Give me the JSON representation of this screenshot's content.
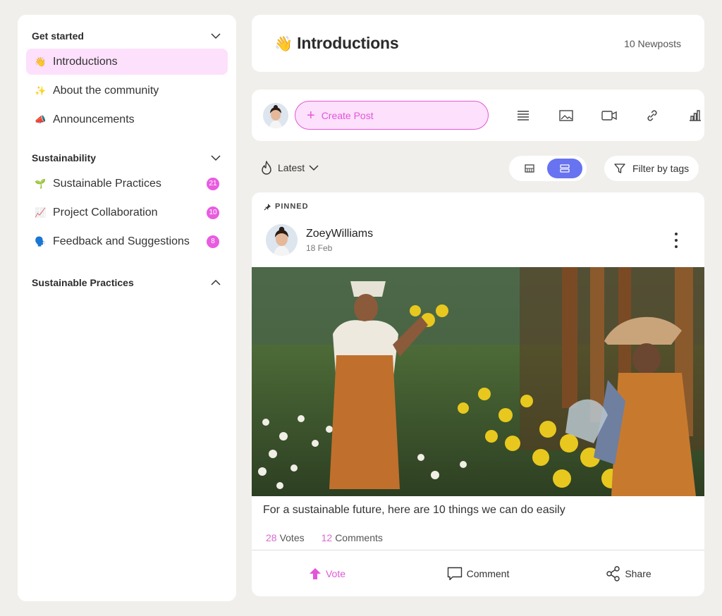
{
  "colors": {
    "accent": "#e257d8",
    "accent_soft": "#fde0fb",
    "primary": "#6773f0",
    "badge": "#e85ce0"
  },
  "sidebar": {
    "sections": [
      {
        "title": "Get started",
        "expanded": true,
        "items": [
          {
            "emoji": "👋",
            "label": "Introductions",
            "active": true
          },
          {
            "emoji": "✨",
            "label": "About the community"
          },
          {
            "emoji": "📣",
            "label": "Announcements"
          }
        ]
      },
      {
        "title": "Sustainability",
        "expanded": true,
        "items": [
          {
            "emoji": "🌱",
            "label": "Sustainable Practices",
            "badge": "21"
          },
          {
            "emoji": "📈",
            "label": "Project Collaboration",
            "badge": "10"
          },
          {
            "emoji": "🗣️",
            "label": "Feedback and Suggestions",
            "badge": "8"
          }
        ]
      },
      {
        "title": "Sustainable Practices",
        "expanded": false
      }
    ]
  },
  "header": {
    "emoji": "👋",
    "title": "Introductions",
    "new_posts": "10 Newposts"
  },
  "composer": {
    "create_label": "Create Post",
    "tools": [
      "text-icon",
      "image-icon",
      "video-icon",
      "link-icon",
      "poll-icon"
    ]
  },
  "feed": {
    "sort_label": "Latest",
    "view_modes": [
      "grid",
      "list"
    ],
    "selected_view": "list",
    "filter_label": "Filter by tags"
  },
  "post": {
    "pinned_label": "PINNED",
    "author": "ZoeyWilliams",
    "date": "18 Feb",
    "caption": "For a sustainable future, here are 10 things we can do easily",
    "votes_count": "28",
    "votes_label": "Votes",
    "comments_count": "12",
    "comments_label": "Comments",
    "actions": {
      "vote": "Vote",
      "comment": "Comment",
      "share": "Share"
    }
  }
}
